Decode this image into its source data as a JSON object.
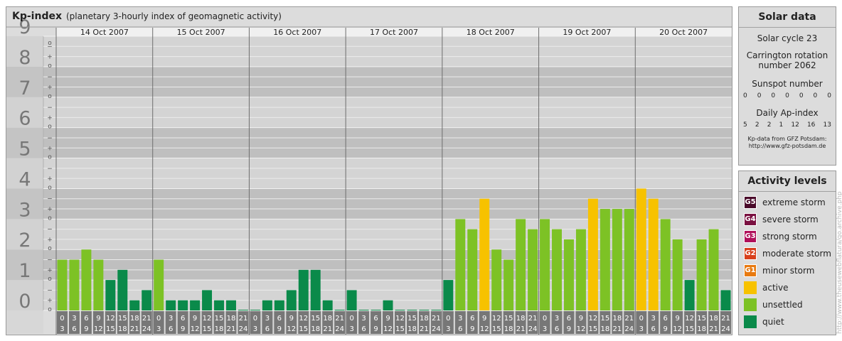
{
  "title": "Kp-index",
  "subtitle": "(planetary 3-hourly index of geomagnetic activity)",
  "chart_data": {
    "type": "bar",
    "title": "Kp-index",
    "subtitle": "(planetary 3-hourly index of geomagnetic activity)",
    "ylim": [
      0,
      9
    ],
    "y_major_ticks": [
      "0",
      "1",
      "2",
      "3",
      "4",
      "5",
      "6",
      "7",
      "8",
      "9"
    ],
    "y_minor_ticks": [
      "o",
      "+",
      "−"
    ],
    "days": [
      "14 Oct 2007",
      "15 Oct 2007",
      "16 Oct 2007",
      "17 Oct 2007",
      "18 Oct 2007",
      "19 Oct 2007",
      "20 Oct 2007"
    ],
    "hour_start": [
      "0",
      "3",
      "6",
      "9",
      "12",
      "15",
      "18",
      "21"
    ],
    "hour_end": [
      "3",
      "6",
      "9",
      "12",
      "15",
      "18",
      "21",
      "24"
    ],
    "values": [
      [
        1.667,
        1.667,
        2.0,
        1.667,
        1.0,
        1.333,
        0.333,
        0.667
      ],
      [
        1.667,
        0.333,
        0.333,
        0.333,
        0.667,
        0.333,
        0.333,
        0.0
      ],
      [
        0.0,
        0.333,
        0.333,
        0.667,
        1.333,
        1.333,
        0.333,
        0.0
      ],
      [
        0.667,
        0.0,
        0.0,
        0.333,
        0.0,
        0.0,
        0.0,
        0.0
      ],
      [
        1.0,
        3.0,
        2.667,
        3.667,
        2.0,
        1.667,
        3.0,
        2.667
      ],
      [
        3.0,
        2.667,
        2.333,
        2.667,
        3.667,
        3.333,
        3.333,
        3.333
      ],
      [
        4.0,
        3.667,
        3.0,
        2.333,
        1.0,
        2.333,
        2.667,
        0.667
      ]
    ],
    "color_levels": {
      "quiet": "#0a8a4a",
      "unsettled": "#7dc225",
      "active": "#f7c200"
    }
  },
  "solar": {
    "title": "Solar data",
    "cycle": "Solar cycle 23",
    "carrington_line1": "Carrington rotation",
    "carrington_line2": "number 2062",
    "sunspot_label": "Sunspot number",
    "sunspot": [
      "0",
      "0",
      "0",
      "0",
      "0",
      "0",
      "0"
    ],
    "ap_label": "Daily Ap-index",
    "ap": [
      "5",
      "2",
      "2",
      "1",
      "12",
      "16",
      "13"
    ],
    "source_line1": "Kp-data from GFZ Potsdam:",
    "source_line2": "http://www.gfz-potsdam.de"
  },
  "activity": {
    "title": "Activity levels",
    "levels": [
      {
        "code": "G5",
        "label": "extreme storm",
        "color": "#4a0a2a"
      },
      {
        "code": "G4",
        "label": "severe storm",
        "color": "#7a1040"
      },
      {
        "code": "G3",
        "label": "strong storm",
        "color": "#b0105a"
      },
      {
        "code": "G2",
        "label": "moderate storm",
        "color": "#d8401c"
      },
      {
        "code": "G1",
        "label": "minor storm",
        "color": "#e87a10"
      },
      {
        "code": "",
        "label": "active",
        "color": "#f7c200"
      },
      {
        "code": "",
        "label": "unsettled",
        "color": "#7dc225"
      },
      {
        "code": "",
        "label": "quiet",
        "color": "#0a8a4a"
      }
    ]
  },
  "watermark": "http://www.theusewebflatura/go.archive.php"
}
